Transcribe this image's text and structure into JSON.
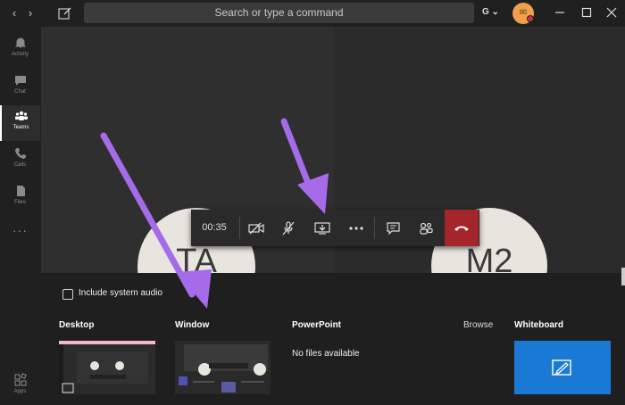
{
  "titlebar": {
    "search_placeholder": "Search or type a command",
    "account_label": "G ⌄",
    "avatar_initials": "✉"
  },
  "rail": {
    "items": [
      {
        "label": "Activity",
        "icon": "bell-icon"
      },
      {
        "label": "Chat",
        "icon": "chat-icon"
      },
      {
        "label": "Teams",
        "icon": "teams-icon",
        "active": true
      },
      {
        "label": "Calls",
        "icon": "phone-icon"
      },
      {
        "label": "Files",
        "icon": "file-icon"
      },
      {
        "label": "",
        "icon": "more-icon"
      },
      {
        "label": "Apps",
        "icon": "apps-icon"
      }
    ]
  },
  "participants": [
    {
      "initials": "TA"
    },
    {
      "initials": "M2"
    }
  ],
  "callbar": {
    "timer": "00:35",
    "buttons": [
      "camera-off-icon",
      "mic-off-icon",
      "share-screen-icon",
      "more-icon",
      "chat-icon",
      "participants-icon",
      "hang-up-icon"
    ]
  },
  "share_tray": {
    "include_audio_label": "Include system audio",
    "sections": {
      "desktop": "Desktop",
      "window": "Window",
      "powerpoint": "PowerPoint",
      "browse": "Browse",
      "whiteboard": "Whiteboard"
    },
    "no_files_text": "No files available"
  },
  "colors": {
    "background": "#1f1f1f",
    "accent": "#1979d4",
    "hangup": "#a4262c",
    "arrow": "#a66be8"
  }
}
